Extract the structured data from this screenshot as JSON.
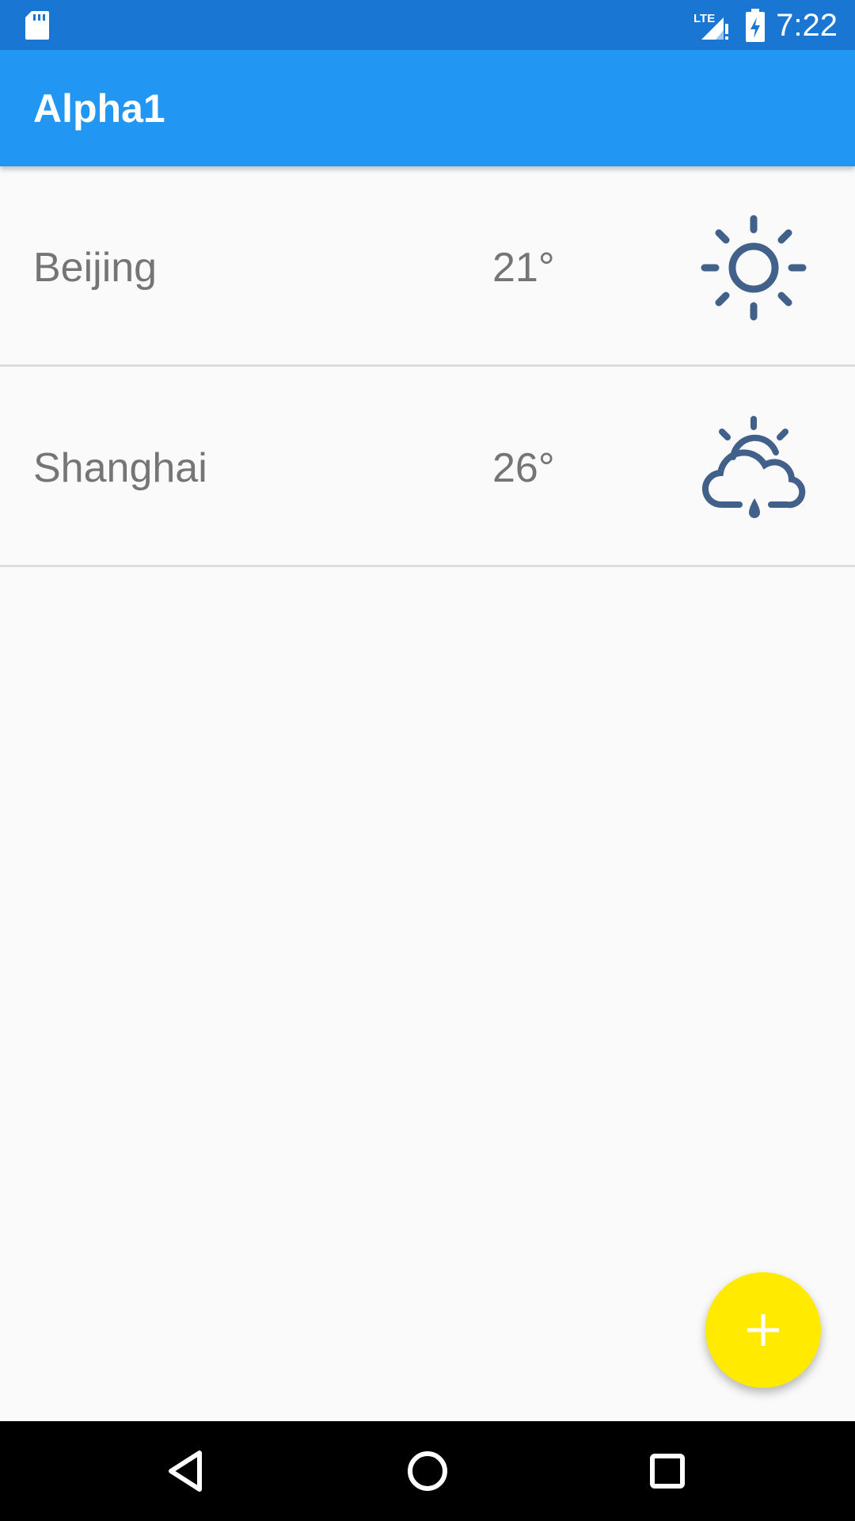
{
  "status_bar": {
    "time": "7:22",
    "network": "LTE",
    "icons": [
      "sd-card-icon",
      "signal-lte-icon",
      "battery-charging-icon"
    ]
  },
  "app_bar": {
    "title": "Alpha1"
  },
  "cities": [
    {
      "name": "Beijing",
      "temperature": "21°",
      "icon": "sun-icon"
    },
    {
      "name": "Shanghai",
      "temperature": "26°",
      "icon": "partly-cloudy-rain-icon"
    }
  ],
  "fab": {
    "icon": "plus-icon"
  },
  "nav_bar": {
    "icons": [
      "back-icon",
      "home-icon",
      "recent-apps-icon"
    ]
  },
  "colors": {
    "status_bar": "#1976d2",
    "app_bar": "#2196f3",
    "fab": "#ffea00",
    "weather_icon": "#41618a",
    "text_secondary": "#757575"
  }
}
